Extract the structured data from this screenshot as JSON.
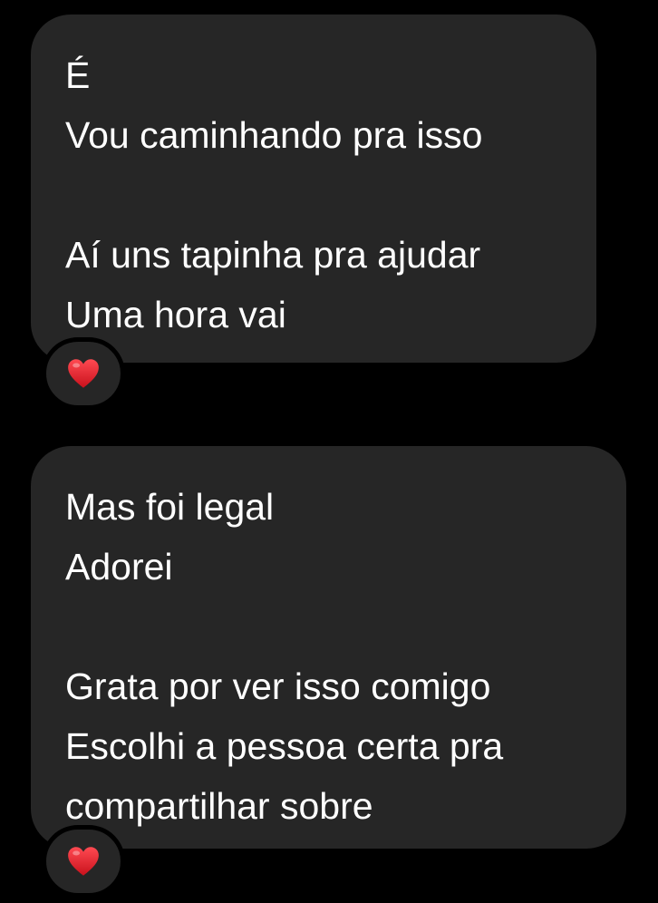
{
  "conversation": {
    "messages": [
      {
        "lines": [
          "É",
          "Vou caminhando pra isso",
          "",
          "Aí uns tapinha pra ajudar",
          "Uma hora vai"
        ],
        "reaction": "heart-emoji"
      },
      {
        "lines": [
          "Mas foi legal",
          "Adorei",
          "",
          "Grata por ver isso comigo",
          "Escolhi a pessoa certa pra",
          "compartilhar sobre"
        ],
        "reaction": "heart-emoji"
      }
    ]
  },
  "colors": {
    "background": "#000000",
    "bubble": "#262626",
    "text": "#ffffff",
    "heart": "#e3262f"
  }
}
